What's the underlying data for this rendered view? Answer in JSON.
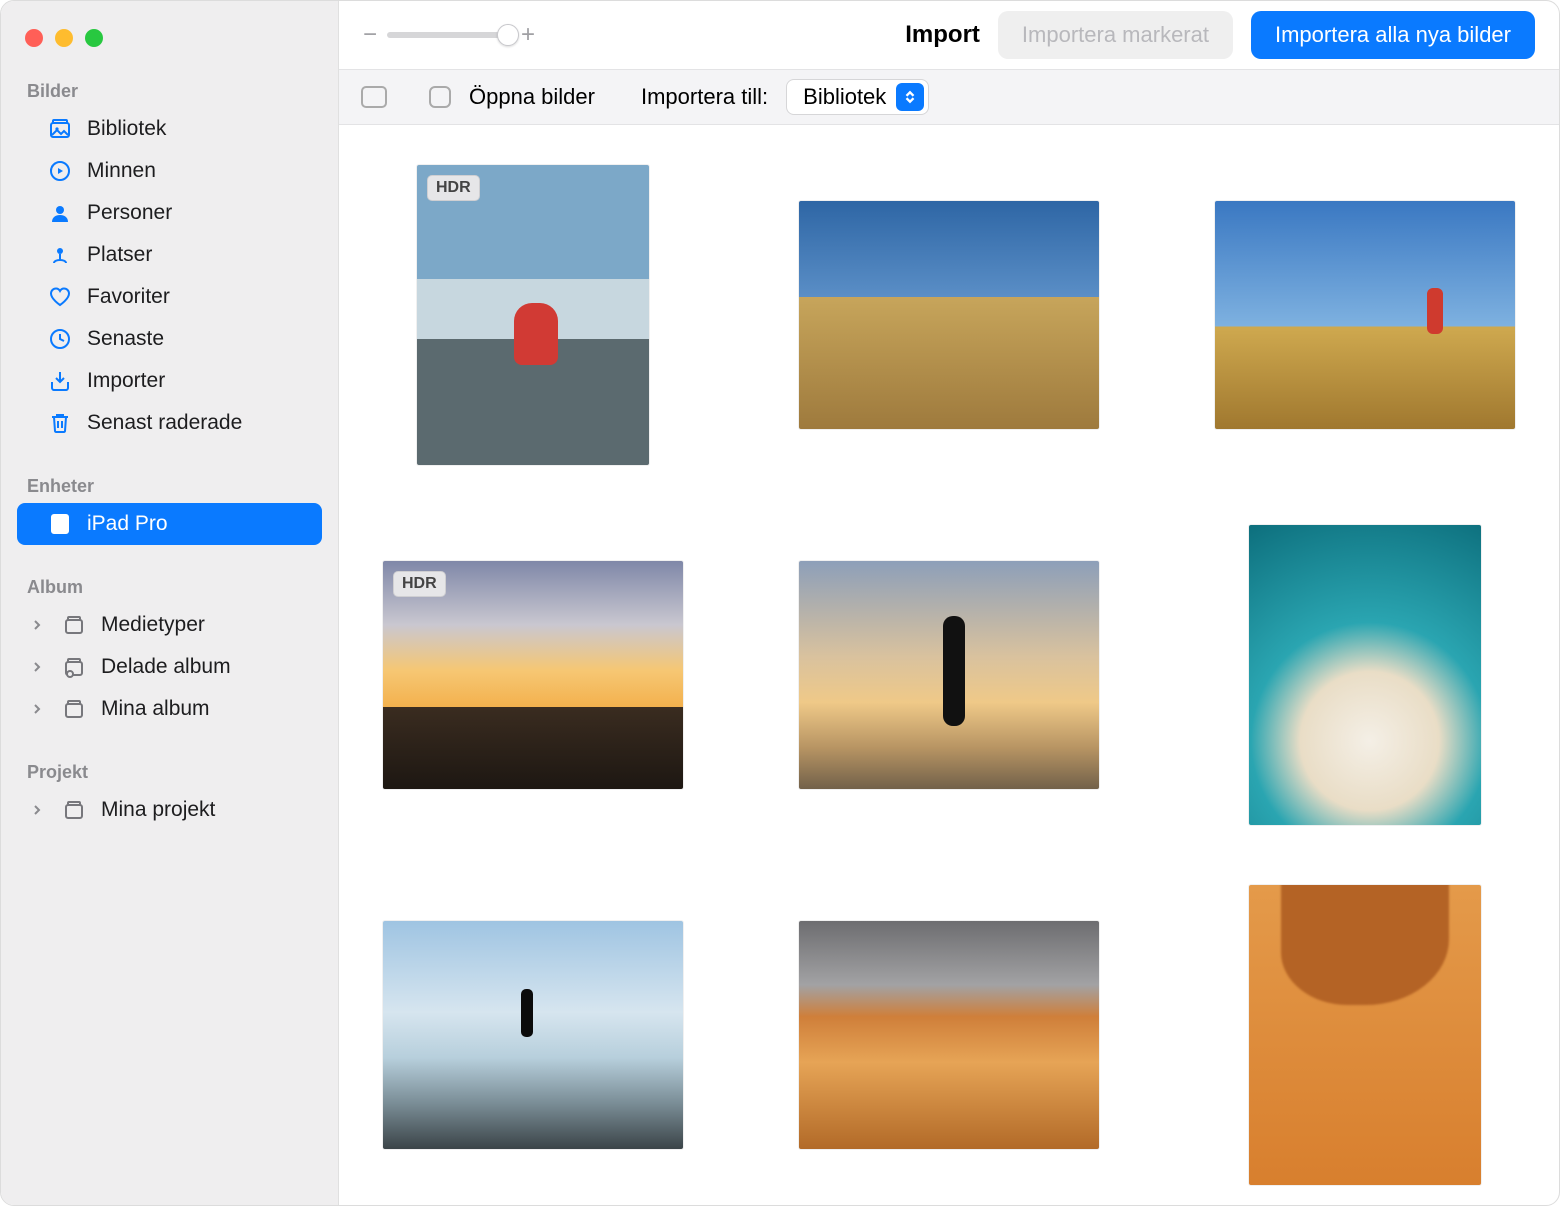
{
  "sidebar": {
    "sections": {
      "photos": {
        "heading": "Bilder",
        "items": [
          {
            "label": "Bibliotek"
          },
          {
            "label": "Minnen"
          },
          {
            "label": "Personer"
          },
          {
            "label": "Platser"
          },
          {
            "label": "Favoriter"
          },
          {
            "label": "Senaste"
          },
          {
            "label": "Importer"
          },
          {
            "label": "Senast raderade"
          }
        ]
      },
      "devices": {
        "heading": "Enheter",
        "items": [
          {
            "label": "iPad Pro",
            "selected": true
          }
        ]
      },
      "albums": {
        "heading": "Album",
        "items": [
          {
            "label": "Medietyper"
          },
          {
            "label": "Delade album"
          },
          {
            "label": "Mina album"
          }
        ]
      },
      "projects": {
        "heading": "Projekt",
        "items": [
          {
            "label": "Mina projekt"
          }
        ]
      }
    }
  },
  "toolbar": {
    "title": "Import",
    "import_selected": "Importera markerat",
    "import_all": "Importera alla nya bilder",
    "zoom_minus": "−",
    "zoom_plus": "+"
  },
  "subbar": {
    "open_photos": "Öppna bilder",
    "import_to_label": "Importera till:",
    "import_to_value": "Bibliotek"
  },
  "badges": {
    "hdr": "HDR"
  },
  "photos": [
    {
      "orientation": "portrait",
      "hdr": true,
      "paint": "p1"
    },
    {
      "orientation": "landscape",
      "hdr": false,
      "paint": "p2"
    },
    {
      "orientation": "landscape",
      "hdr": false,
      "paint": "p3"
    },
    {
      "orientation": "landscape",
      "hdr": true,
      "paint": "p4"
    },
    {
      "orientation": "landscape",
      "hdr": false,
      "paint": "p5"
    },
    {
      "orientation": "portrait",
      "hdr": false,
      "paint": "p6"
    },
    {
      "orientation": "landscape",
      "hdr": false,
      "paint": "p7"
    },
    {
      "orientation": "landscape",
      "hdr": false,
      "paint": "p8"
    },
    {
      "orientation": "portrait",
      "hdr": false,
      "paint": "p9"
    }
  ]
}
